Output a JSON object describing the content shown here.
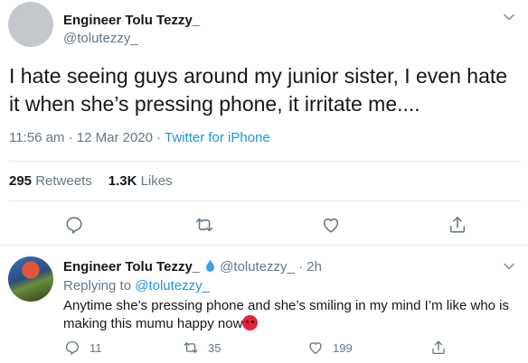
{
  "main_tweet": {
    "author_name": "Engineer Tolu Tezzy_",
    "author_handle": "@tolutezzy_",
    "text": "I hate seeing guys around my junior sister, I even hate it when she’s pressing phone, it irritate me....",
    "time_date": "11:56 am · 12 Mar 2020 · ",
    "source": "Twitter for iPhone",
    "retweets_count": "295",
    "retweets_label": "Retweets",
    "likes_count": "1.3K",
    "likes_label": "Likes",
    "actions": [
      "reply-icon",
      "retweet-icon",
      "like-icon",
      "share-icon"
    ]
  },
  "reply_tweet": {
    "author_name": "Engineer Tolu Tezzy_",
    "author_handle": "@tolutezzy_",
    "time": " · 2h",
    "replying_to_label": "Replying to ",
    "replying_to_handle": "@tolutezzy_",
    "text": "Anytime she’s pressing phone and she’s smiling in my mind I’m like who is making this mumu happy now",
    "reply_count": "11",
    "retweet_count": "35",
    "like_count": "199"
  },
  "colors": {
    "text": "#14171a",
    "secondary": "#657786",
    "link": "#1b95e0",
    "divider": "#e6ecf0"
  }
}
